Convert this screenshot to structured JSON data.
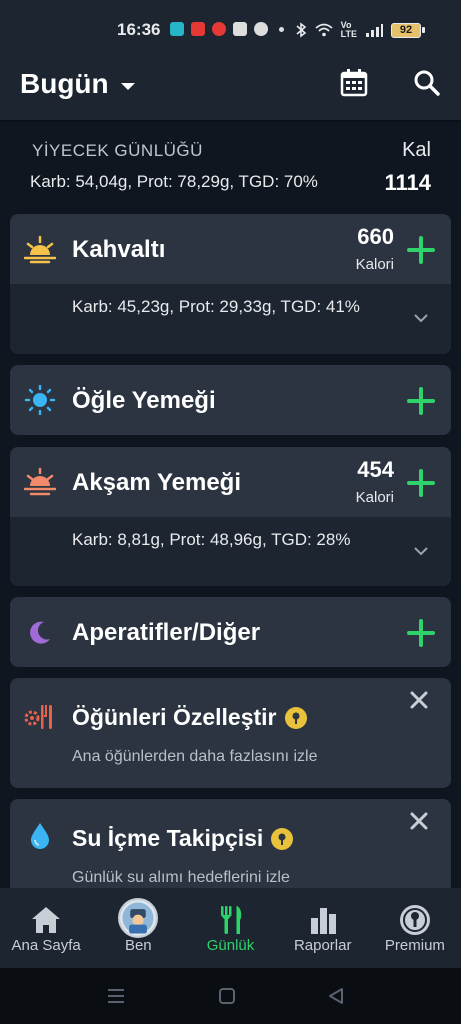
{
  "status_bar": {
    "time": "16:36",
    "battery": "92"
  },
  "header": {
    "title": "Bugün"
  },
  "summary": {
    "title": "YİYECEK GÜNLÜĞÜ",
    "kal_label": "Kal",
    "macros": "Karb: 54,04g, Prot: 78,29g, TGD: 70%",
    "total_calories": "1114"
  },
  "meals": [
    {
      "name": "Kahvaltı",
      "calories": "660",
      "cal_unit": "Kalori",
      "macros": "Karb: 45,23g, Prot: 29,33g, TGD: 41%",
      "icon": "sunrise-icon"
    },
    {
      "name": "Öğle Yemeği",
      "icon": "sun-icon"
    },
    {
      "name": "Akşam Yemeği",
      "calories": "454",
      "cal_unit": "Kalori",
      "macros": "Karb: 8,81g, Prot: 48,96g, TGD: 28%",
      "icon": "sunset-icon"
    },
    {
      "name": "Aperatifler/Diğer",
      "icon": "moon-icon"
    }
  ],
  "promos": [
    {
      "title": "Öğünleri Özelleştir",
      "subtitle": "Ana öğünlerden daha fazlasını izle",
      "icon": "fork-knife-gear-icon"
    },
    {
      "title": "Su İçme Takipçisi",
      "subtitle": "Günlük su alımı hedeflerini izle",
      "icon": "water-drop-icon"
    }
  ],
  "nav": [
    {
      "label": "Ana Sayfa",
      "icon": "home-icon"
    },
    {
      "label": "Ben",
      "icon": "avatar-icon"
    },
    {
      "label": "Günlük",
      "icon": "fork-knife-icon",
      "active": true
    },
    {
      "label": "Raporlar",
      "icon": "bar-chart-icon"
    },
    {
      "label": "Premium",
      "icon": "premium-key-icon"
    }
  ],
  "colors": {
    "accent": "#2ed36a",
    "card": "#2b3440",
    "background": "#0f1620",
    "premium": "#e8c23a"
  }
}
